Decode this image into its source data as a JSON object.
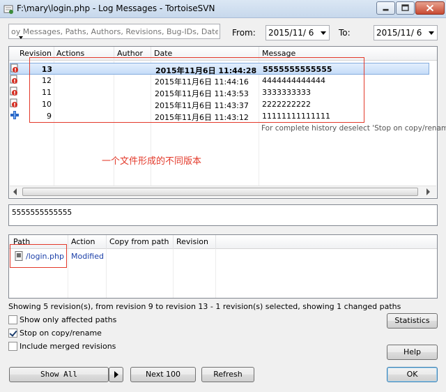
{
  "window": {
    "title": "F:\\mary\\login.php - Log Messages - TortoiseSVN"
  },
  "filter": {
    "search_placeholder": "oy Messages, Paths, Authors, Revisions, Bug-IDs, Date, Date",
    "from_label": "From:",
    "from_value": "2015/11/  6",
    "to_label": "To:",
    "to_value": "2015/11/  6"
  },
  "log": {
    "columns": [
      "Revision",
      "Actions",
      "Author",
      "Date",
      "Message"
    ],
    "rows": [
      {
        "revision": "13",
        "date": "2015年11月6日 11:44:28",
        "message": "5555555555555",
        "selected": true,
        "action_icon": "modified-icon"
      },
      {
        "revision": "12",
        "date": "2015年11月6日 11:44:16",
        "message": "4444444444444",
        "selected": false,
        "action_icon": "modified-icon"
      },
      {
        "revision": "11",
        "date": "2015年11月6日 11:43:53",
        "message": "3333333333",
        "selected": false,
        "action_icon": "modified-icon"
      },
      {
        "revision": "10",
        "date": "2015年11月6日 11:43:37",
        "message": "2222222222",
        "selected": false,
        "action_icon": "modified-icon"
      },
      {
        "revision": "9",
        "date": "2015年11月6日 11:43:12",
        "message": "11111111111111",
        "selected": false,
        "action_icon": "added-icon"
      }
    ],
    "history_note": "For complete history deselect 'Stop on copy/rename'",
    "annotation": "一个文件形成的不同版本"
  },
  "message_text": "5555555555555",
  "paths": {
    "columns": [
      "Path",
      "Action",
      "Copy from path",
      "Revision"
    ],
    "rows": [
      {
        "path": "/login.php",
        "action": "Modified",
        "copy_from": "",
        "revision": ""
      }
    ]
  },
  "status_text": "Showing 5 revision(s), from revision 9 to revision 13 - 1 revision(s) selected, showing 1 changed paths",
  "options": {
    "affected_label": "Show only affected paths",
    "affected_checked": false,
    "stop_label": "Stop on copy/rename",
    "stop_checked": true,
    "merged_label": "Include merged revisions",
    "merged_checked": false
  },
  "buttons": {
    "show_all": "Show All",
    "next": "Next 100",
    "refresh": "Refresh",
    "statistics": "Statistics",
    "help": "Help",
    "ok": "OK"
  },
  "colors": {
    "annotation_red": "#e3392a",
    "link_blue": "#1b3fa8",
    "selection_blue": "#c5dcf8"
  }
}
